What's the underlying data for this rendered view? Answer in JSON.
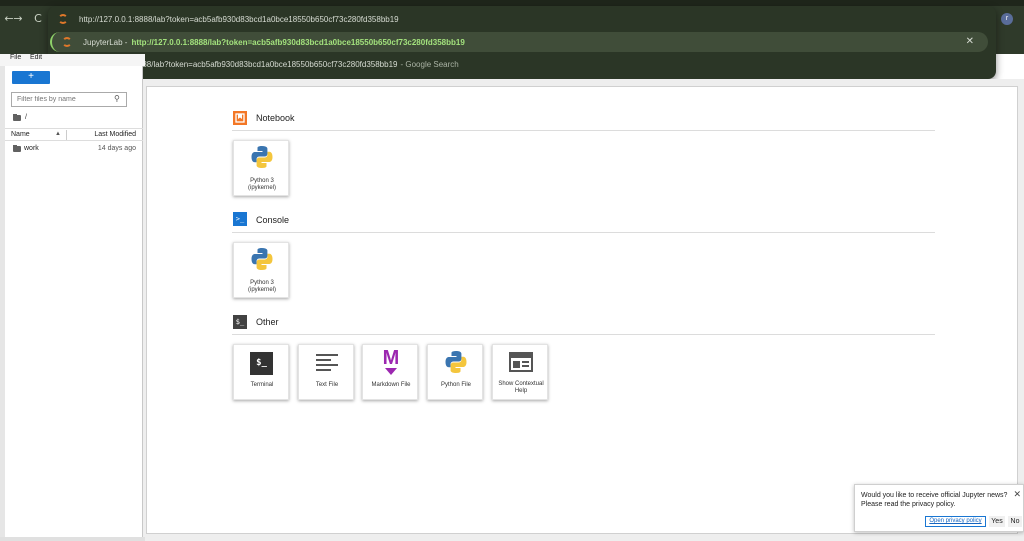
{
  "browser": {
    "back_glyph": "←",
    "forward_glyph": "→",
    "reload_glyph": "C",
    "profile_initial": "r",
    "omnibox": {
      "rows": [
        {
          "url": "http://127.0.0.1:8888/lab?token=acb5afb930d83bcd1a0bce18550b650cf73c280fd358bb19"
        },
        {
          "title": "JupyterLab - ",
          "url": "http://127.0.0.1:8888/lab?token=acb5afb930d83bcd1a0bce18550b650cf73c280fd358bb19"
        },
        {
          "query": "http://127.0.0.1:8888/lab?token=acb5afb930d83bcd1a0bce18550b650cf73c280fd358bb19",
          "suffix": "- Google Search"
        }
      ],
      "close_glyph": "✕",
      "search_glyph": "🔍",
      "accent_color": "#a3e27d"
    }
  },
  "menu": {
    "items": [
      "File",
      "Edit"
    ]
  },
  "filebrowser": {
    "new_launcher_label": "+",
    "filter_placeholder": "Filter files by name",
    "breadcrumb": "/",
    "columns": {
      "name": "Name",
      "modified": "Last Modified",
      "sort_glyph": "▲"
    },
    "files": [
      {
        "name": "work",
        "modified": "14 days ago",
        "type": "folder-icon"
      }
    ]
  },
  "launcher": {
    "sections": {
      "notebook": {
        "title": "Notebook",
        "icon": "notebook-icon",
        "color": "#f37726"
      },
      "console": {
        "title": "Console",
        "icon": "console-icon",
        "color": "#1976d2",
        "glyph": ">_"
      },
      "other": {
        "title": "Other",
        "icon": "other-icon",
        "color": "#424242",
        "glyph": "$_"
      }
    },
    "notebook_cards": [
      {
        "label_line1": "Python 3",
        "label_line2": "(ipykernel)",
        "icon": "python-icon"
      }
    ],
    "console_cards": [
      {
        "label_line1": "Python 3",
        "label_line2": "(ipykernel)",
        "icon": "python-icon"
      }
    ],
    "other_cards": [
      {
        "label_line1": "Terminal",
        "label_line2": "",
        "icon": "terminal-icon"
      },
      {
        "label_line1": "Text File",
        "label_line2": "",
        "icon": "text-file-icon"
      },
      {
        "label_line1": "Markdown File",
        "label_line2": "",
        "icon": "markdown-icon"
      },
      {
        "label_line1": "Python File",
        "label_line2": "",
        "icon": "python-icon"
      },
      {
        "label_line1": "Show Contextual",
        "label_line2": "Help",
        "icon": "contextual-help-icon"
      }
    ],
    "terminal_glyph": "$_",
    "markdown_glyph": "M"
  },
  "notification": {
    "message": "Would you like to receive official Jupyter news? Please read the privacy policy.",
    "privacy_link": "Open privacy policy",
    "yes_label": "Yes",
    "no_label": "No",
    "close_glyph": "✕"
  }
}
